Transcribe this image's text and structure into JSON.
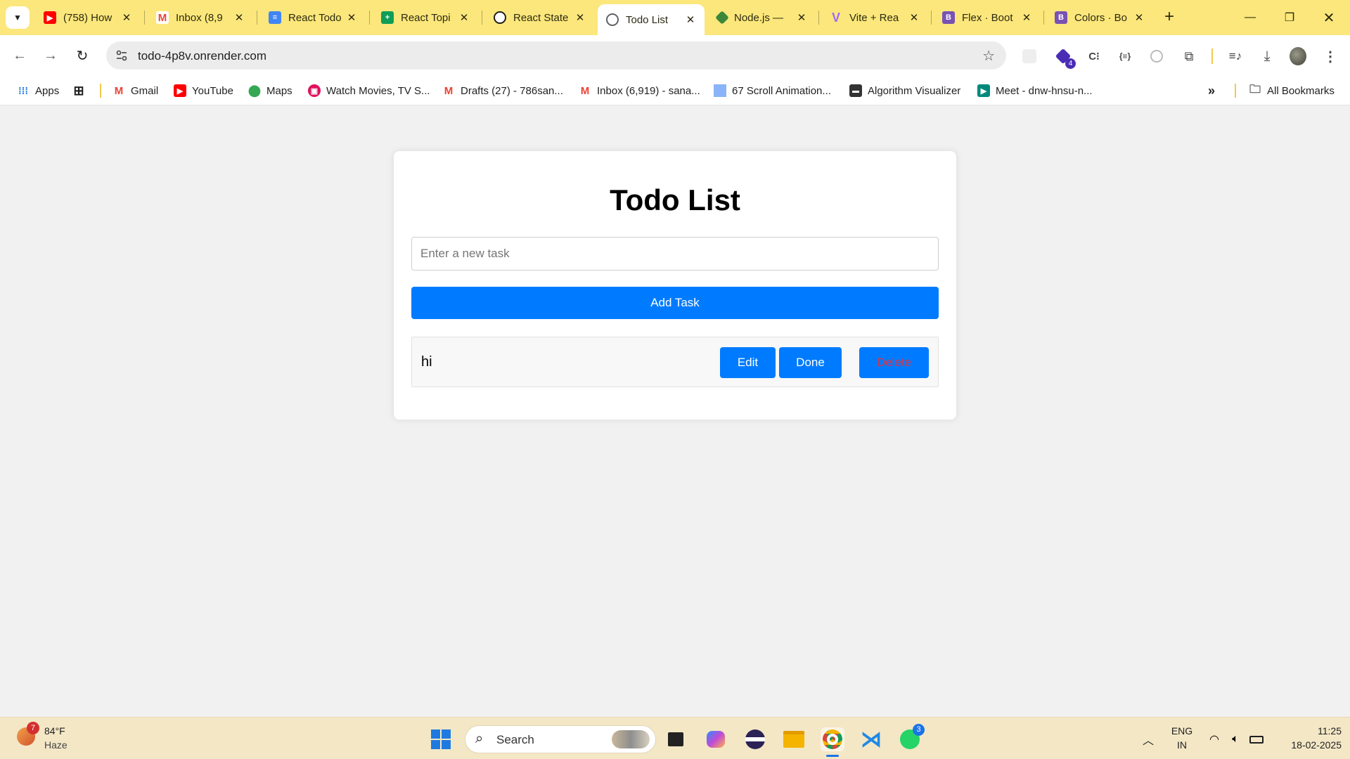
{
  "browser": {
    "tabs": [
      {
        "title": "(758) How",
        "icon": "youtube-icon",
        "color": "#ff0000"
      },
      {
        "title": "Inbox (8,9",
        "icon": "gmail-icon",
        "color": "#ea4335"
      },
      {
        "title": "React Todo",
        "icon": "docs-icon",
        "color": "#4285f4"
      },
      {
        "title": "React Topi",
        "icon": "sheets-icon",
        "color": "#0f9d58"
      },
      {
        "title": "React State",
        "icon": "chatgpt-icon",
        "color": "#1f1f1f"
      },
      {
        "title": "Todo List",
        "icon": "globe-icon",
        "color": "#5f6368",
        "active": true
      },
      {
        "title": "Node.js —",
        "icon": "nodejs-icon",
        "color": "#3c873a"
      },
      {
        "title": "Vite + Rea",
        "icon": "vite-icon",
        "color": "#9f6bff"
      },
      {
        "title": "Flex · Boot",
        "icon": "bootstrap-icon",
        "color": "#7952b3"
      },
      {
        "title": "Colors · Bo",
        "icon": "bootstrap-icon",
        "color": "#7952b3"
      }
    ],
    "address": "todo-4p8v.onrender.com",
    "extension_badge": "4",
    "bookmarks": [
      {
        "label": "Apps",
        "icon": "apps-grid-icon"
      },
      {
        "label": "Gmail",
        "icon": "gmail-icon",
        "color": "#ea4335"
      },
      {
        "label": "YouTube",
        "icon": "youtube-icon",
        "color": "#ff0000"
      },
      {
        "label": "Maps",
        "icon": "maps-icon",
        "color": "#34a853"
      },
      {
        "label": "Watch Movies, TV S...",
        "icon": "movies-icon",
        "color": "#e0115f"
      },
      {
        "label": "Drafts (27) - 786san...",
        "icon": "gmail-icon",
        "color": "#ea4335"
      },
      {
        "label": "Inbox (6,919) - sana...",
        "icon": "gmail-icon",
        "color": "#ea4335"
      },
      {
        "label": "67 Scroll Animation...",
        "icon": "image-icon",
        "color": "#8ab4f8"
      },
      {
        "label": "Algorithm Visualizer",
        "icon": "terminal-icon",
        "color": "#333333"
      },
      {
        "label": "Meet - dnw-hnsu-n...",
        "icon": "meet-icon",
        "color": "#00897b"
      }
    ],
    "all_bookmarks": "All Bookmarks"
  },
  "app": {
    "title": "Todo List",
    "input_placeholder": "Enter a new task",
    "input_value": "",
    "add_button": "Add Task",
    "todos": [
      {
        "text": "hi",
        "edit_label": "Edit",
        "done_label": "Done",
        "delete_label": "Delete"
      }
    ],
    "accent_color": "#007bff",
    "delete_text_color": "#dc3545"
  },
  "taskbar": {
    "weather": {
      "temp": "84°F",
      "condition": "Haze",
      "badge": "7"
    },
    "search_label": "Search",
    "whatsapp_badge": "3",
    "language": {
      "line1": "ENG",
      "line2": "IN"
    },
    "time": "11:25",
    "date": "18-02-2025"
  }
}
